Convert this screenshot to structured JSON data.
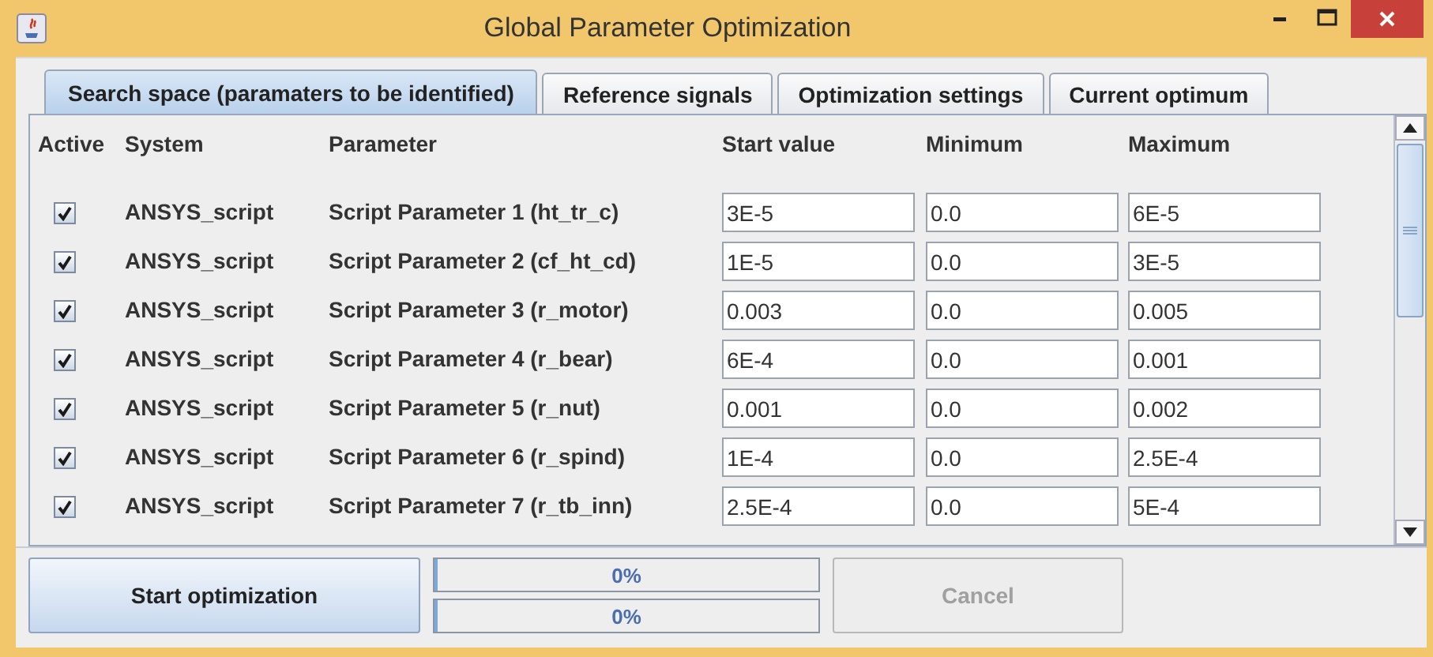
{
  "window": {
    "title": "Global Parameter Optimization"
  },
  "tabs": [
    {
      "label": "Search space (paramaters to be identified)",
      "selected": true
    },
    {
      "label": "Reference signals",
      "selected": false
    },
    {
      "label": "Optimization settings",
      "selected": false
    },
    {
      "label": "Current optimum",
      "selected": false
    }
  ],
  "table": {
    "columns": [
      "Active",
      "System",
      "Parameter",
      "Start value",
      "Minimum",
      "Maximum"
    ],
    "rows": [
      {
        "active": true,
        "system": "ANSYS_script",
        "parameter": "Script Parameter 1 (ht_tr_c)",
        "start": "3E-5",
        "min": "0.0",
        "max": "6E-5"
      },
      {
        "active": true,
        "system": "ANSYS_script",
        "parameter": "Script Parameter 2 (cf_ht_cd)",
        "start": "1E-5",
        "min": "0.0",
        "max": "3E-5"
      },
      {
        "active": true,
        "system": "ANSYS_script",
        "parameter": "Script Parameter 3 (r_motor)",
        "start": "0.003",
        "min": "0.0",
        "max": "0.005"
      },
      {
        "active": true,
        "system": "ANSYS_script",
        "parameter": "Script Parameter 4 (r_bear)",
        "start": "6E-4",
        "min": "0.0",
        "max": "0.001"
      },
      {
        "active": true,
        "system": "ANSYS_script",
        "parameter": "Script Parameter 5 (r_nut)",
        "start": "0.001",
        "min": "0.0",
        "max": "0.002"
      },
      {
        "active": true,
        "system": "ANSYS_script",
        "parameter": "Script Parameter 6 (r_spind)",
        "start": "1E-4",
        "min": "0.0",
        "max": "2.5E-4"
      },
      {
        "active": true,
        "system": "ANSYS_script",
        "parameter": "Script Parameter 7 (r_tb_inn)",
        "start": "2.5E-4",
        "min": "0.0",
        "max": "5E-4"
      }
    ]
  },
  "footer": {
    "start_button": {
      "label": "Start optimization",
      "disabled": false
    },
    "progress": [
      {
        "label": "0%",
        "level": 0
      },
      {
        "label": "0%",
        "level": 0
      }
    ],
    "cancel_button": {
      "label": "Cancel",
      "disabled": true
    }
  }
}
